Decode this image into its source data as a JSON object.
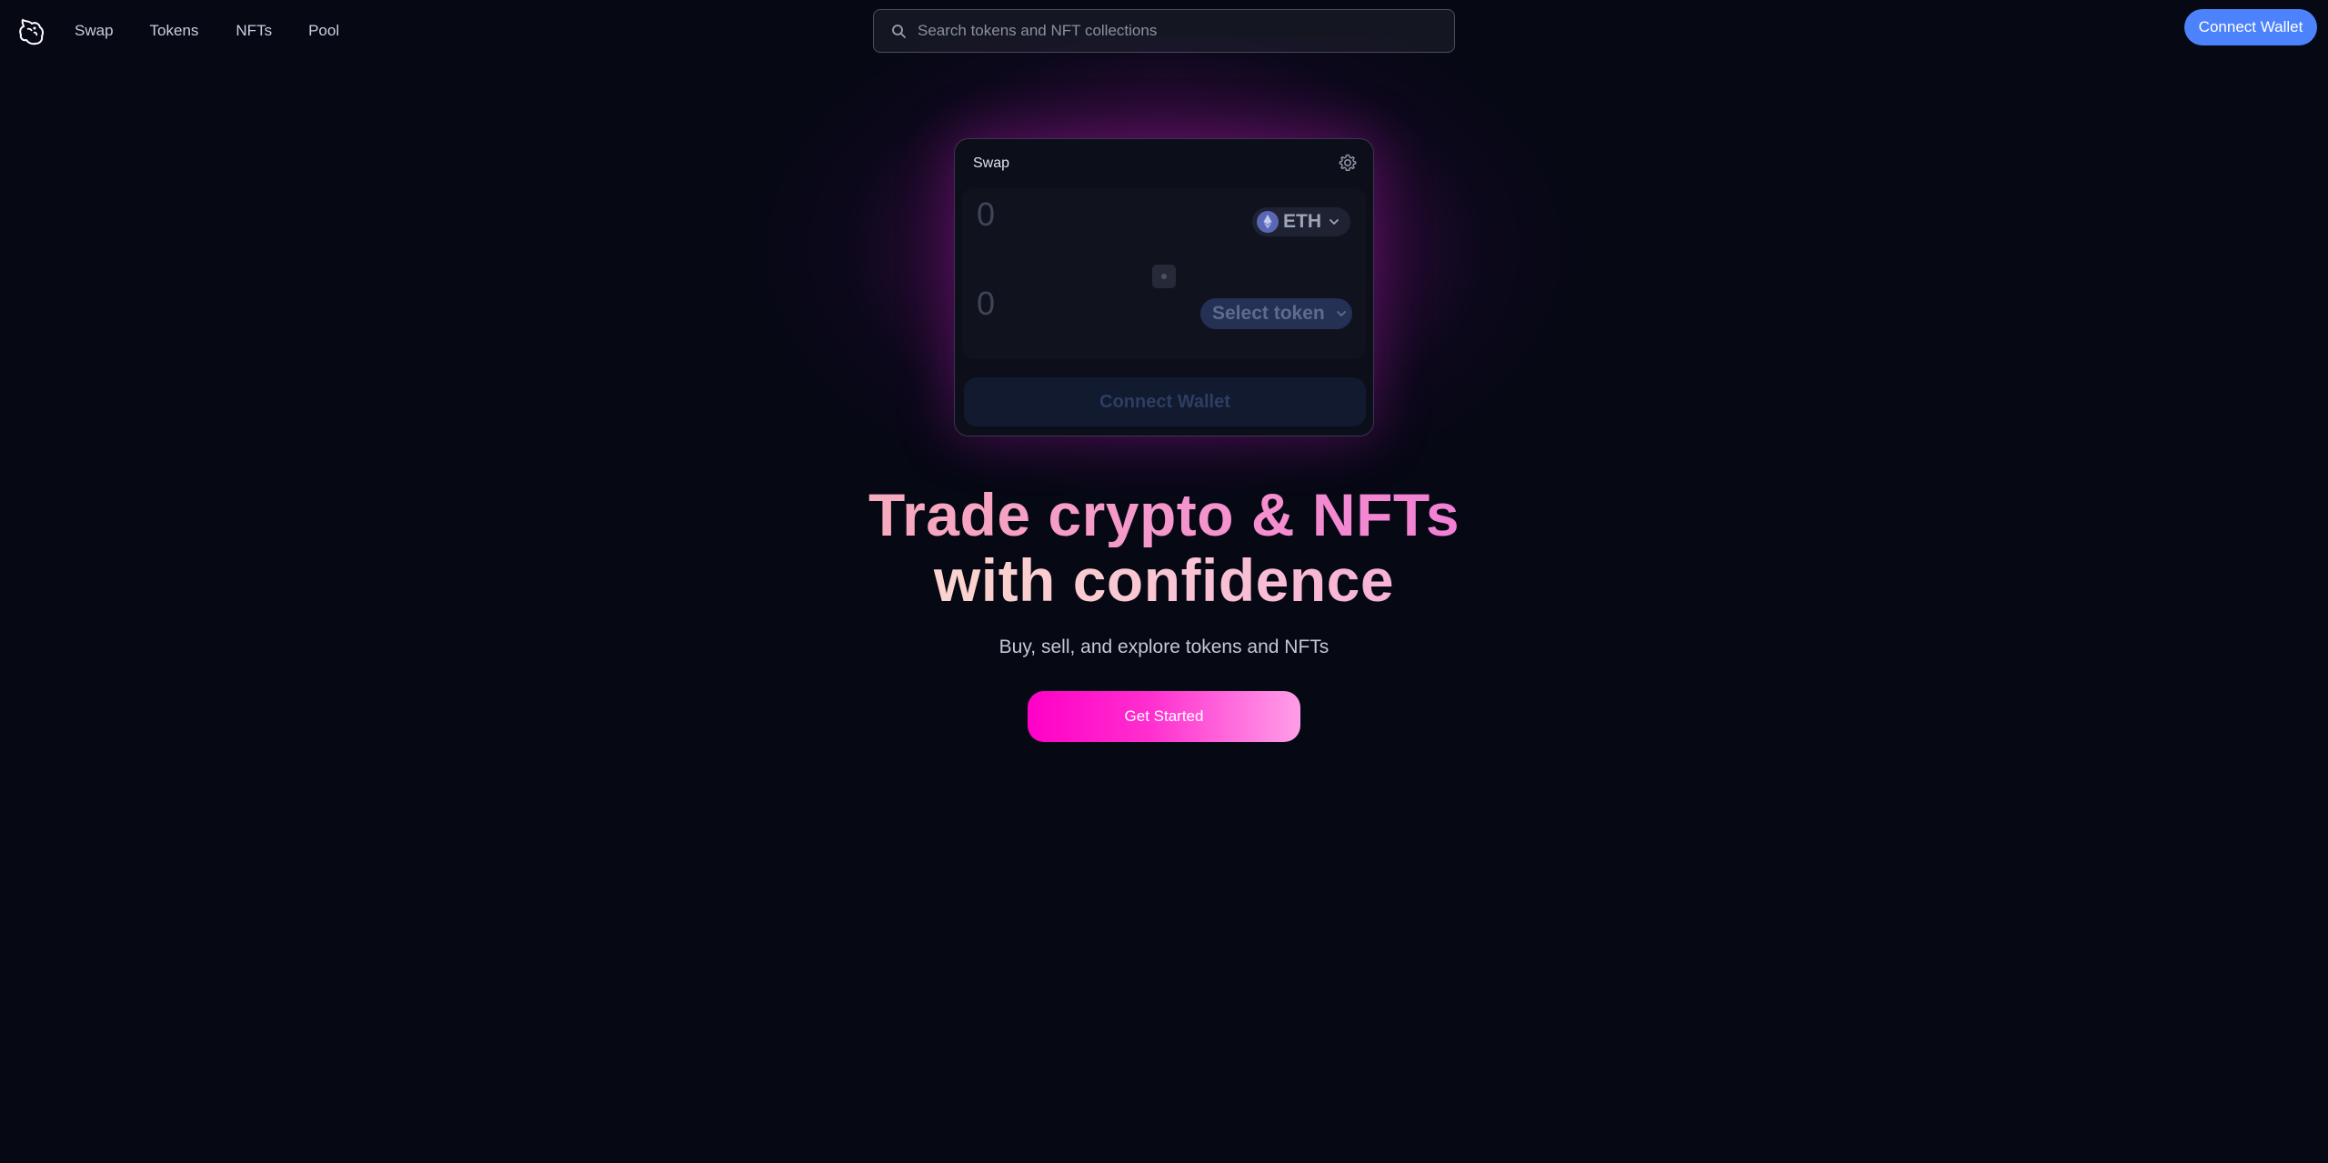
{
  "nav": {
    "links": [
      "Swap",
      "Tokens",
      "NFTs",
      "Pool"
    ],
    "search_placeholder": "Search tokens and NFT collections",
    "connect_label": "Connect Wallet"
  },
  "swap_card": {
    "title": "Swap",
    "input_amount_placeholder": "0",
    "output_amount_placeholder": "0",
    "input_token": "ETH",
    "output_token_label": "Select token",
    "connect_label": "Connect Wallet"
  },
  "hero": {
    "title_line1": "Trade crypto & NFTs",
    "title_line2": "with confidence",
    "subtitle": "Buy, sell, and explore tokens and NFTs",
    "cta_label": "Get Started"
  },
  "colors": {
    "background": "#060814",
    "accent_blue": "#4c82fb",
    "accent_pink": "#ff00c7"
  },
  "icons": {
    "logo": "unicorn-logo-icon",
    "search": "search-icon",
    "settings": "gear-icon",
    "eth": "ethereum-icon",
    "chevron": "chevron-down-icon",
    "switch": "swap-direction-icon"
  }
}
